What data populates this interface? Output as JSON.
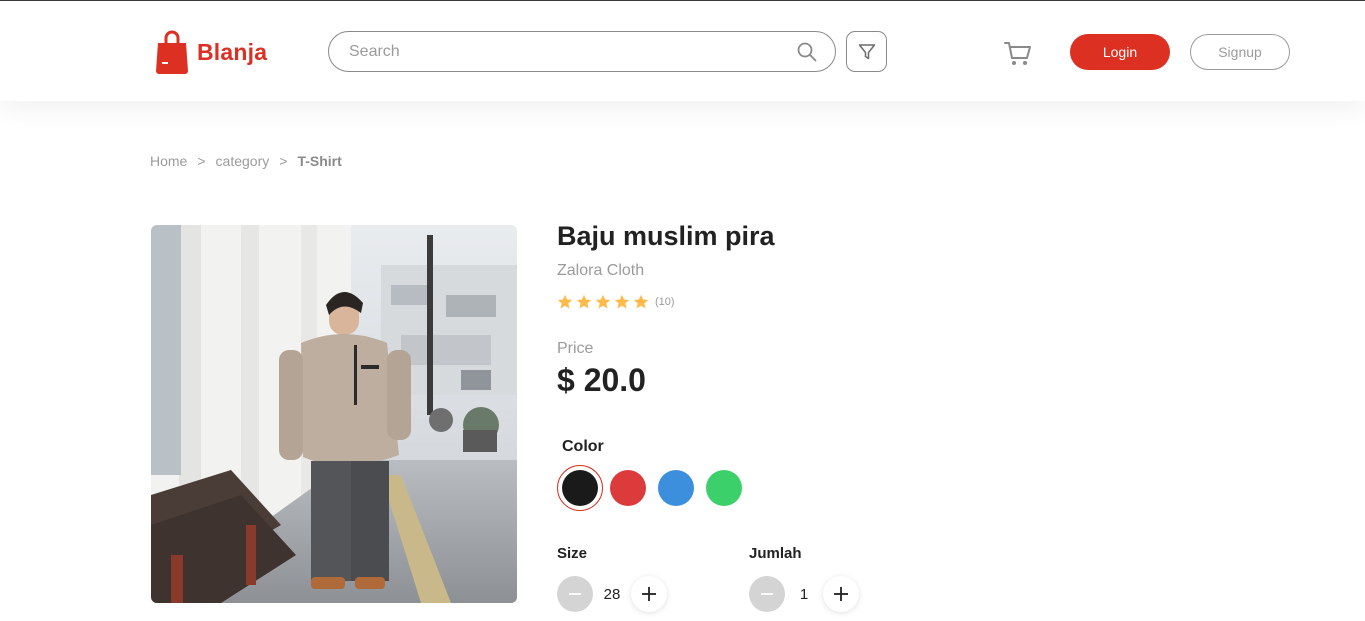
{
  "brand": {
    "name": "Blanja",
    "accent": "#db3022"
  },
  "header": {
    "search_placeholder": "Search",
    "login_label": "Login",
    "signup_label": "Signup",
    "icons": [
      "shopping-bag-icon",
      "search-icon",
      "filter-icon",
      "cart-icon"
    ]
  },
  "breadcrumb": {
    "items": [
      "Home",
      "category",
      "T-Shirt"
    ],
    "separator": ">"
  },
  "product": {
    "title": "Baju muslim pira",
    "brand": "Zalora Cloth",
    "rating": 5,
    "rating_count": "(10)",
    "price_label": "Price",
    "price": "$ 20.0",
    "color_label": "Color",
    "colors": [
      "#1a1a1a",
      "#db3b3b",
      "#3b8fdc",
      "#3bd069"
    ],
    "selected_color_index": 0,
    "size_label": "Size",
    "size_value": "28",
    "qty_label": "Jumlah",
    "qty_value": "1"
  }
}
